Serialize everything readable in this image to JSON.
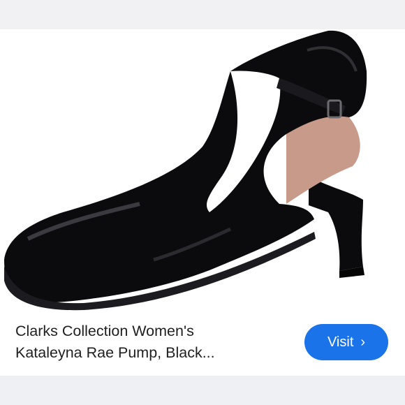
{
  "product": {
    "title_line1": "Clarks Collection Women's",
    "title_line2": "Kataleyna Rae Pump, Black..."
  },
  "visit_button": {
    "label": "Visit",
    "icon": "chevron-right-icon",
    "color": "#1a73e8"
  },
  "colors": {
    "shoe": "#0b0b0d",
    "lining": "#c79a8a"
  }
}
